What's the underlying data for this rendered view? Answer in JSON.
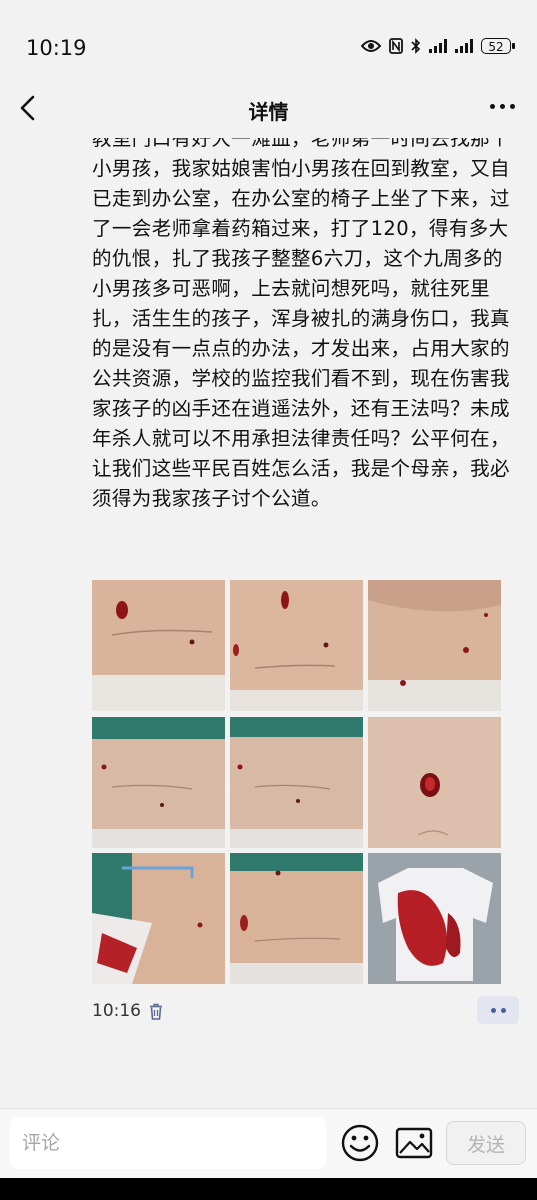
{
  "status_bar": {
    "time": "10:19",
    "battery": "52",
    "icons": [
      "eye-icon",
      "nfc-icon",
      "bluetooth-icon",
      "signal-icon",
      "signal-icon",
      "battery-icon"
    ]
  },
  "nav": {
    "title": "详情",
    "back_icon": "chevron-left-icon",
    "more_icon": "more-horizontal-icon"
  },
  "post": {
    "text": "教室门口有好大一滩血，老师第一时间去找那个小男孩，我家姑娘害怕小男孩在回到教室，又自已走到办公室，在办公室的椅子上坐了下来，过了一会老师拿着药箱过来，打了120，得有多大的仇恨，扎了我孩子整整6六刀，这个九周多的小男孩多可恶啊，上去就问想死吗，就往死里扎，活生生的孩子，浑身被扎的满身伤口，我真的是没有一点点的办法，才发出来，占用大家的公共资源，学校的监控我们看不到，现在伤害我家孩子的凶手还在逍遥法外，还有王法吗？未成年杀人就可以不用承担法律责任吗？公平何在，让我们这些平民百姓怎么活，我是个母亲，我必须得为我家孩子讨个公道。",
    "photos": [
      {
        "name": "photo-1",
        "subject": "wound-photo"
      },
      {
        "name": "photo-2",
        "subject": "wound-photo"
      },
      {
        "name": "photo-3",
        "subject": "wound-photo"
      },
      {
        "name": "photo-4",
        "subject": "wound-photo"
      },
      {
        "name": "photo-5",
        "subject": "wound-photo"
      },
      {
        "name": "photo-6",
        "subject": "wound-photo"
      },
      {
        "name": "photo-7",
        "subject": "wound-photo"
      },
      {
        "name": "photo-8",
        "subject": "wound-photo"
      },
      {
        "name": "photo-9",
        "subject": "bloodied-shirt-photo"
      }
    ],
    "time": "10:16",
    "delete_icon": "trash-icon",
    "more_icon": "more-pill-icon"
  },
  "input_bar": {
    "placeholder": "评论",
    "emoji_icon": "emoji-icon",
    "image_icon": "image-icon",
    "send_label": "发送"
  },
  "colors": {
    "background": "#f2f2f2",
    "text": "#111111",
    "send_disabled": "#b5b5b5",
    "link_accent": "#46609c"
  }
}
